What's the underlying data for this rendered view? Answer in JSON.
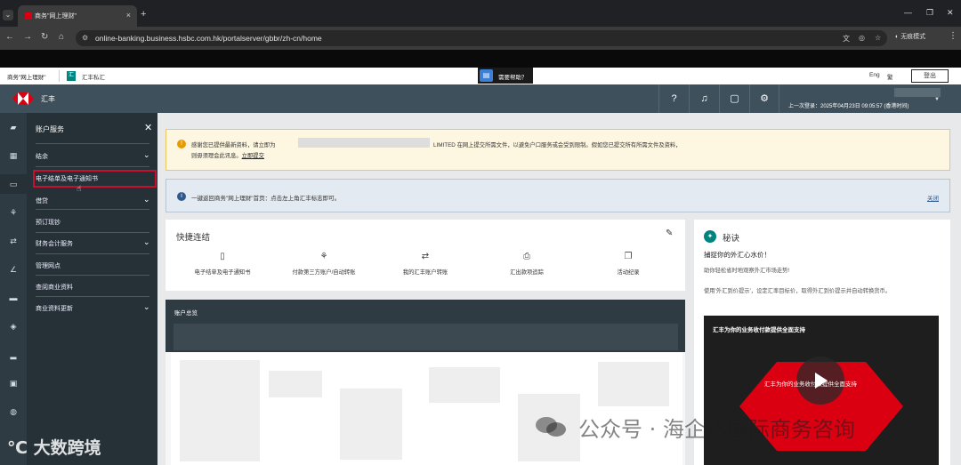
{
  "browser": {
    "tab_title": "商务\"网上理财\"",
    "url": "online-banking.business.hsbc.com.hk/portalserver/gbbr/zh-cn/home",
    "profile_label": "无痕模式"
  },
  "topstrip": {
    "business_label": "商务\"网上理财\"",
    "hk_label": "汇丰私汇",
    "help_label": "需要帮助？",
    "lang_eng": "Eng",
    "lang_trad": "繁",
    "logout_label": "登出"
  },
  "header": {
    "brand": "汇丰",
    "last_login": "上一次登录：2025年04月23日 09:05:57 (香港时间)"
  },
  "sidemenu": {
    "title": "账户服务",
    "items": [
      {
        "label": "结余",
        "has_chevron": true
      },
      {
        "label": "电子结单及电子通知书",
        "has_chevron": false,
        "active": true
      },
      {
        "label": "借贷",
        "has_chevron": true
      },
      {
        "label": "预订现钞",
        "has_chevron": false
      },
      {
        "label": "财务会计服务",
        "has_chevron": true
      },
      {
        "label": "管理网点",
        "has_chevron": false
      },
      {
        "label": "查阅商业资料",
        "has_chevron": false
      },
      {
        "label": "商业资料更新",
        "has_chevron": true
      }
    ]
  },
  "notice": {
    "text_a": "感谢您已提供最新资料，请立即为",
    "text_b": "LIMITED 在网上提交所需文件，以避免户口服务或会受到限制。假如您已提交所有所需文件及资料，",
    "text_c": "则毋须理会此讯息。",
    "link": "立即提交"
  },
  "info": {
    "text": "一键返回商务\"网上理财\"首页：点击左上角汇丰标志即可。",
    "close": "关闭"
  },
  "quicklinks": {
    "title": "快捷连结",
    "items": [
      {
        "icon": "document-icon",
        "label": "电子结单及电子通知书"
      },
      {
        "icon": "transfer-icon",
        "label": "付款第三方账户/自动转账"
      },
      {
        "icon": "swap-icon",
        "label": "我的汇丰账户转账"
      },
      {
        "icon": "track-icon",
        "label": "汇出款项追踪"
      },
      {
        "icon": "copy-icon",
        "label": "活动纪录"
      }
    ]
  },
  "account_summary": {
    "title": "账户总览"
  },
  "tips": {
    "title": "秘诀",
    "subtitle": "捕捉你的外汇心水价！",
    "line1": "助你轻松省时地观察外汇市场走势!",
    "line2": "使用'外汇到价提示'，设定汇率目标价，取得外汇到价提示并自动转换货币。",
    "video_title": "汇丰为你的业务收付款提供全面支持",
    "video_caption": "汇丰为你的业务收付款提供全面支持"
  },
  "overlays": {
    "watermark": "公众号 · 海企达国际商务咨询",
    "brandmark": "大数跨境"
  },
  "colors": {
    "hsbc_red": "#db0011",
    "header_bg": "#3e505b",
    "side_bg": "#263137",
    "active_outline": "#c8102e"
  }
}
